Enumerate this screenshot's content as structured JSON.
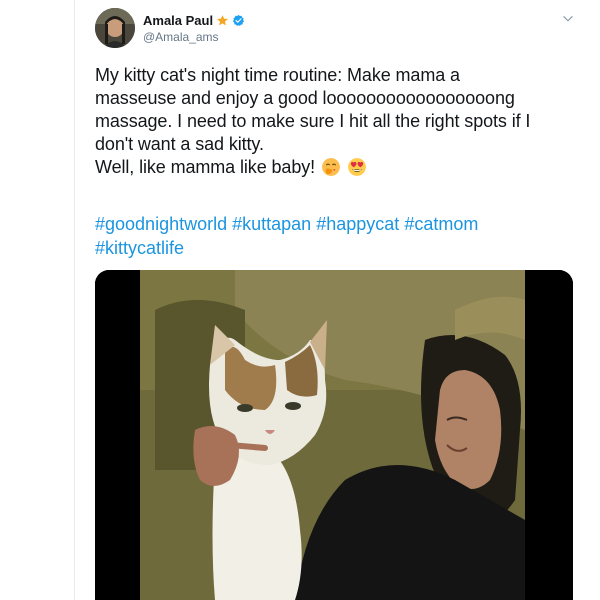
{
  "tweet": {
    "author": {
      "display_name": "Amala Paul",
      "handle": "@Amala_ams",
      "badge_star_color": "#f5a623",
      "verified_color": "#1da1f2"
    },
    "text_lines": [
      "My kitty cat's night time routine:  Make mama a",
      "masseuse and enjoy a good looooooooooooooooong",
      "massage. I need to make sure I hit all the right spots if I",
      "don't want a sad kitty.",
      "Well, like mamma like baby!"
    ],
    "emojis": [
      "face-blowing-kiss-emoji",
      "heart-eyes-emoji"
    ],
    "hashtags": [
      "#goodnightworld",
      "#kuttapan",
      "#happycat",
      "#catmom",
      "#kittycatlife"
    ],
    "media": {
      "type": "video",
      "description_icon": "video-thumbnail"
    },
    "colors": {
      "text": "#14171a",
      "secondary": "#657786",
      "link": "#1b95e0"
    }
  }
}
